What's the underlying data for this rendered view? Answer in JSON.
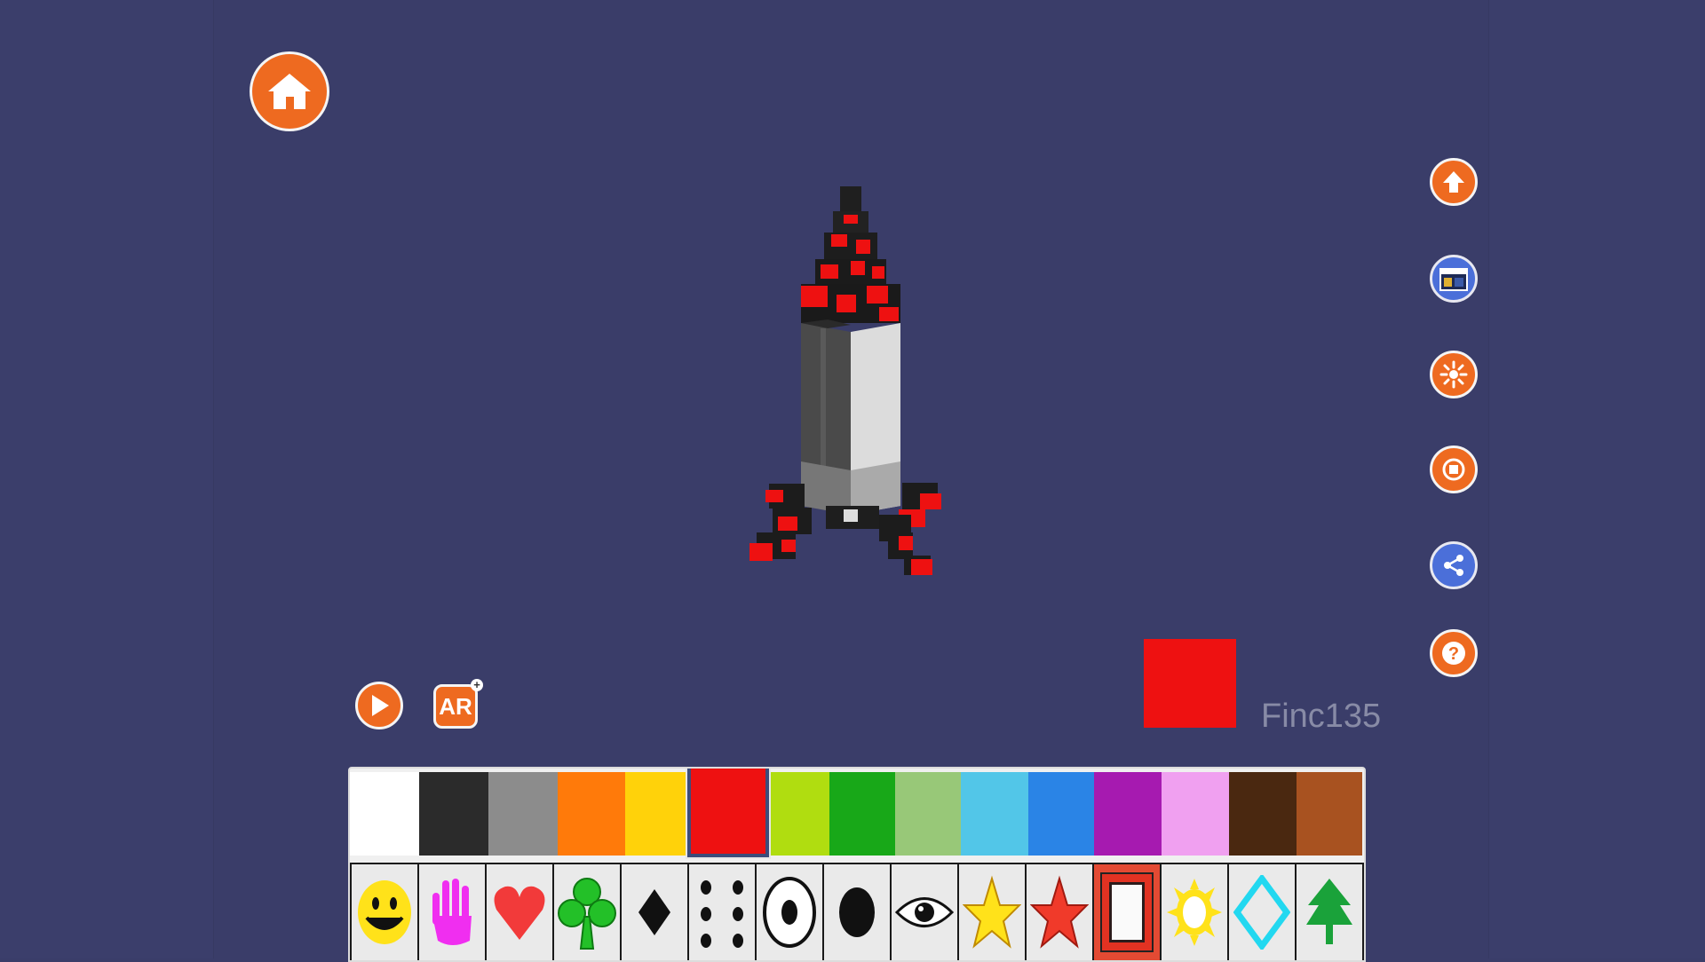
{
  "toolbar": {
    "home_icon": "home-icon",
    "save_icon": "upload-arrow-icon",
    "library_icon": "library-icon",
    "effects_icon": "burst-icon",
    "stop_icon": "stop-icon",
    "share_icon": "share-icon",
    "help_icon": "help-icon",
    "play_icon": "play-icon",
    "ar_label": "AR",
    "ar_badge": "+"
  },
  "canvas": {
    "model_subject": "voxel-rocket",
    "user_id": "Finc135",
    "selected_color": "#ee1111"
  },
  "palette": {
    "colors": [
      "#ffffff",
      "#2b2b2b",
      "#8c8c8c",
      "#ff7a0a",
      "#ffd20a",
      "#ee1111",
      "#b0dd10",
      "#18a818",
      "#98c878",
      "#52c6e8",
      "#2a84e6",
      "#a61ab0",
      "#f0a0f0",
      "#4a2810",
      "#a85220"
    ],
    "selected_color_index": 5,
    "patterns": [
      "smiley-icon",
      "hand-icon",
      "heart-icon",
      "club-icon",
      "diamond-icon",
      "dots-icon",
      "circle-ring-icon",
      "ellipse-icon",
      "eye-icon",
      "star-yellow-icon",
      "star-red-icon",
      "frame-icon",
      "sun-icon",
      "diamond-outline-icon",
      "tree-icon"
    ],
    "selected_pattern_index": 11
  }
}
